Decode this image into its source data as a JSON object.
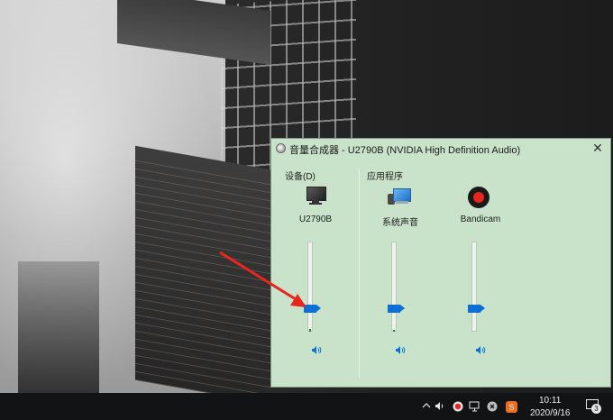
{
  "window": {
    "title": "音量合成器 - U2790B (NVIDIA High Definition Audio)",
    "close_glyph": "✕"
  },
  "sections": {
    "device_label": "设备(D)",
    "apps_label": "应用程序"
  },
  "channels": [
    {
      "name": "U2790B",
      "icon": "monitor-icon",
      "volume": 0.26,
      "peak": 0.03
    },
    {
      "name": "系统声音",
      "icon": "system-sounds-icon",
      "volume": 0.26,
      "peak": 0.02
    },
    {
      "name": "Bandicam",
      "icon": "bandicam-record-icon",
      "volume": 0.26,
      "peak": 0.0
    }
  ],
  "mute_glyph": "🔊",
  "taskbar": {
    "time": "10:11",
    "date": "2020/9/16",
    "notification_count": "3",
    "tray_icons": [
      "chevron-up-icon",
      "speaker-icon",
      "record-icon",
      "network-icon",
      "close-circle-icon",
      "sogou-ime-icon"
    ]
  },
  "colors": {
    "mixer_bg": "#c9e3cb",
    "slider_thumb": "#0a6fd6",
    "annotation_arrow": "#e8261d"
  }
}
